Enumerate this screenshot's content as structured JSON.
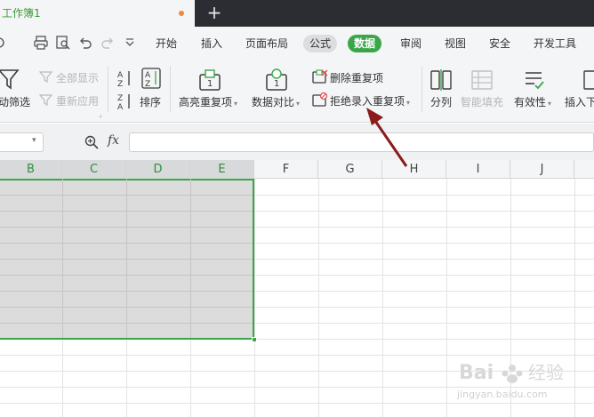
{
  "doc_tab": {
    "title": "工作簿1"
  },
  "new_tab_label": "+",
  "menu": [
    {
      "label": "开始"
    },
    {
      "label": "插入"
    },
    {
      "label": "页面布局"
    },
    {
      "label": "公式"
    },
    {
      "label": "数据"
    },
    {
      "label": "审阅"
    },
    {
      "label": "视图"
    },
    {
      "label": "安全"
    },
    {
      "label": "开发工具"
    }
  ],
  "ribbon": {
    "auto_filter": "动筛选",
    "show_all": "全部显示",
    "reapply": "重新应用",
    "sort": "排序",
    "highlight_dup": "高亮重复项",
    "data_compare": "数据对比",
    "remove_dup": "删除重复项",
    "reject_dup": "拒绝录入重复项",
    "split_col": "分列",
    "smart_fill": "智能填充",
    "validity": "有效性",
    "insert_dropdown": "插入下"
  },
  "formula_bar": {
    "fx_label": "fx",
    "value": ""
  },
  "columns": [
    "B",
    "C",
    "D",
    "E",
    "F",
    "G",
    "H",
    "I",
    "J"
  ],
  "selected_columns": [
    "B",
    "C",
    "D",
    "E"
  ],
  "watermark": {
    "brand": "Bai",
    "brand2": "经验",
    "url": "jingyan.baidu.com"
  }
}
